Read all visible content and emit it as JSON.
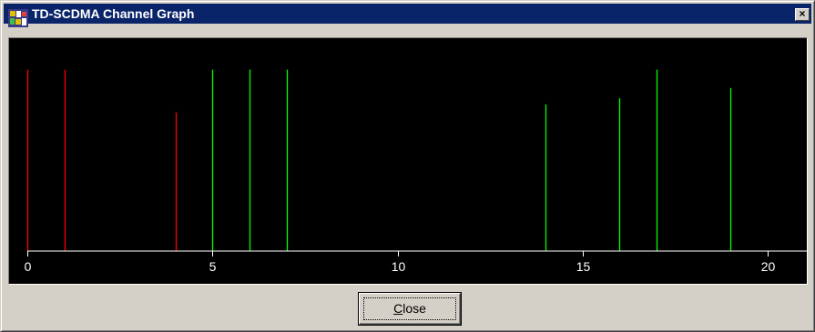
{
  "window": {
    "title": "TD-SCDMA Channel Graph",
    "close_glyph": "×"
  },
  "icons": {
    "app": "app-logo-icon",
    "close": "close-icon"
  },
  "buttons": {
    "close": {
      "mnemonic": "C",
      "rest": "lose"
    }
  },
  "colors": {
    "plot_background": "#000000",
    "axis": "#ffffff",
    "tick_label": "#ffffff",
    "red_series": "#ff0000",
    "green_series": "#00ff00"
  },
  "chart_data": {
    "type": "bar",
    "title": "",
    "xlabel": "",
    "ylabel": "",
    "xlim": [
      0,
      21
    ],
    "ylim": [
      0,
      1
    ],
    "x_ticks": [
      "0",
      "5",
      "10",
      "15",
      "20"
    ],
    "legend": "none",
    "grid": false,
    "series": [
      {
        "color": "red",
        "x": [
          0,
          1,
          4
        ],
        "values": [
          0.89,
          0.89,
          0.68
        ]
      },
      {
        "color": "green",
        "x": [
          5,
          6,
          7,
          14,
          16,
          17,
          19
        ],
        "values": [
          0.89,
          0.89,
          0.89,
          0.72,
          0.75,
          0.89,
          0.8
        ]
      }
    ]
  }
}
